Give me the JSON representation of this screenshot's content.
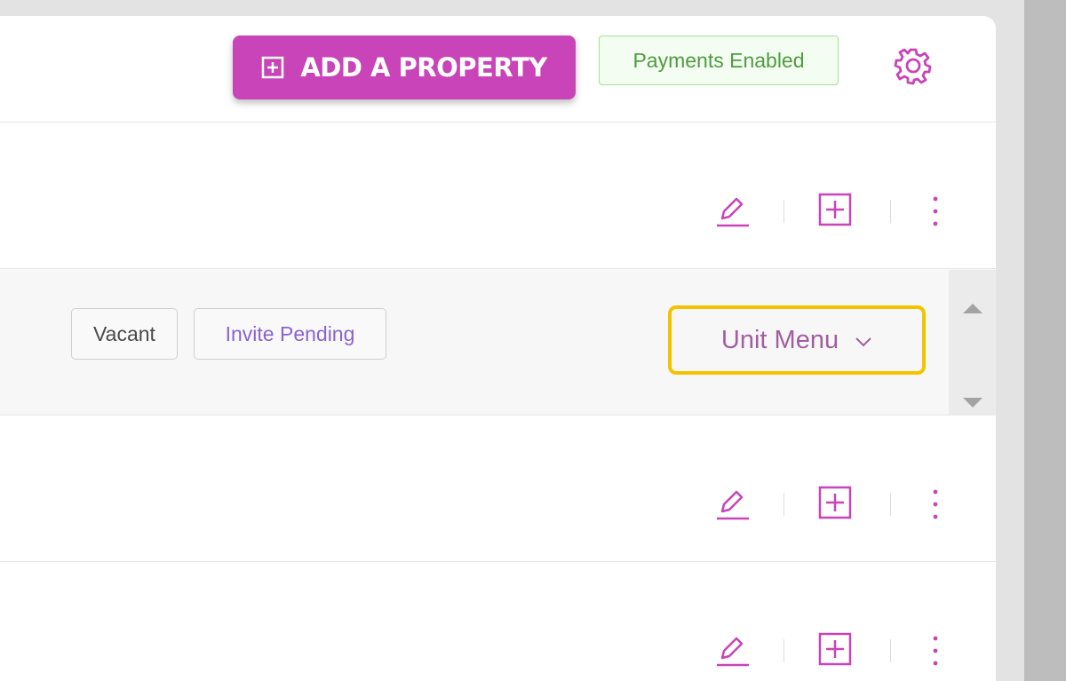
{
  "header": {
    "add_property_label": "ADD A PROPERTY",
    "payments_badge": "Payments Enabled",
    "settings_icon": "gear-icon"
  },
  "rows": [
    {
      "actions": [
        "edit-icon",
        "add-unit-icon",
        "more-vertical-icon"
      ]
    },
    {
      "tags": [
        "Vacant",
        "Invite Pending"
      ],
      "unit_menu_label": "Unit Menu"
    },
    {
      "actions": [
        "edit-icon",
        "add-unit-icon",
        "more-vertical-icon"
      ]
    },
    {
      "actions": [
        "edit-icon",
        "add-unit-icon",
        "more-vertical-icon"
      ]
    }
  ],
  "colors": {
    "brand": "#c944b8",
    "payments_border": "#9fe28e",
    "payments_text": "#4f9c41",
    "unit_menu_text": "#a25f9f",
    "highlight_border": "#f4c300",
    "invite_text": "#8a63d2",
    "vacant_text": "#4a4a4a"
  }
}
